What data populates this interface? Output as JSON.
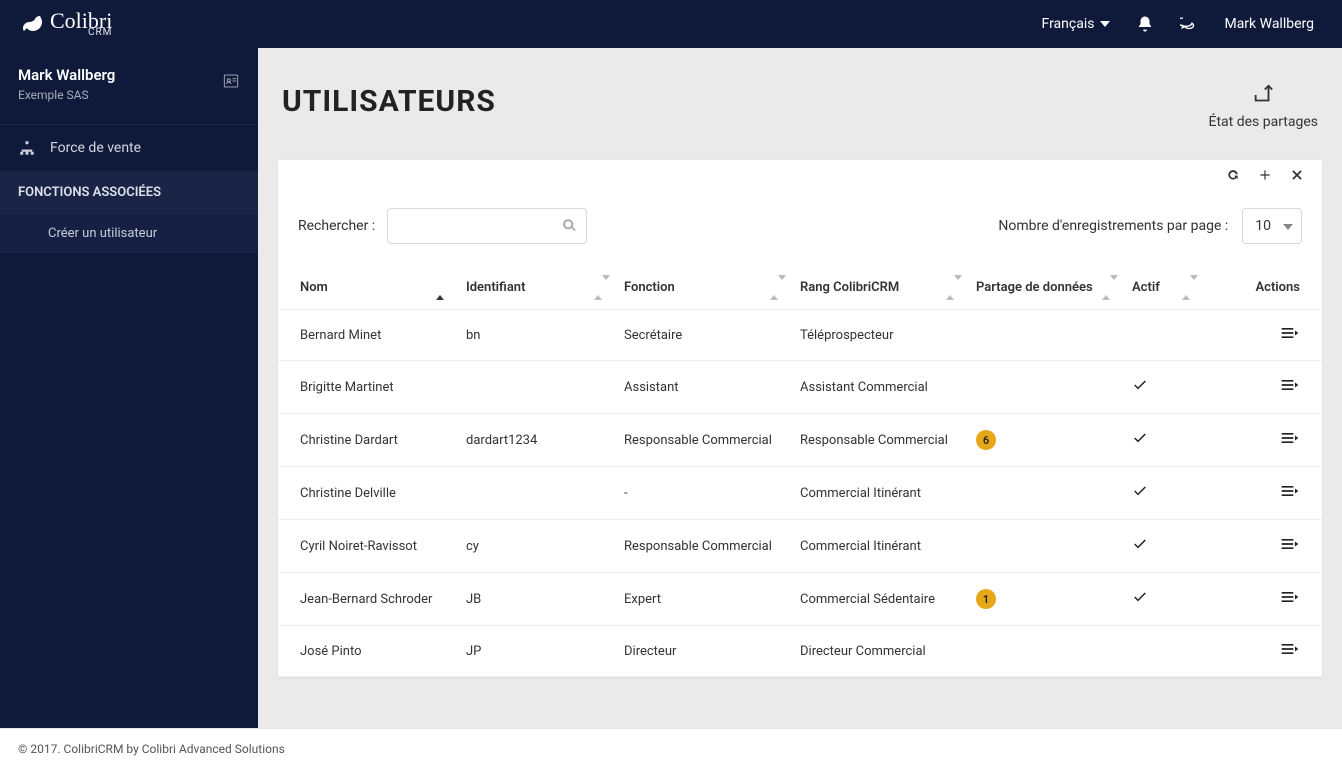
{
  "brand": {
    "name": "Colibri",
    "sub": "CRM"
  },
  "topbar": {
    "language": "Français",
    "user": "Mark Wallberg"
  },
  "sidebar": {
    "user_name": "Mark Wallberg",
    "org": "Exemple SAS",
    "nav": {
      "force_de_vente": "Force de vente"
    },
    "section_title": "FONCTIONS ASSOCIÉES",
    "create_user": "Créer un utilisateur"
  },
  "page": {
    "title": "UTILISATEURS",
    "share_state": "État des partages"
  },
  "controls": {
    "search_label": "Rechercher :",
    "page_size_label": "Nombre d'enregistrements par page :",
    "page_size_value": "10"
  },
  "columns": {
    "nom": "Nom",
    "identifiant": "Identifiant",
    "fonction": "Fonction",
    "rang": "Rang ColibriCRM",
    "partage": "Partage de données",
    "actif": "Actif",
    "actions": "Actions"
  },
  "rows": [
    {
      "nom": "Bernard Minet",
      "identifiant": "bn",
      "fonction": "Secrétaire",
      "rang": "Téléprospecteur",
      "partage": "",
      "actif": false
    },
    {
      "nom": "Brigitte Martinet",
      "identifiant": "",
      "fonction": "Assistant",
      "rang": "Assistant Commercial",
      "partage": "",
      "actif": true
    },
    {
      "nom": "Christine Dardart",
      "identifiant": "dardart1234",
      "fonction": "Responsable Commercial",
      "rang": "Responsable Commercial",
      "partage": "6",
      "actif": true
    },
    {
      "nom": "Christine Delville",
      "identifiant": "",
      "fonction": "-",
      "rang": "Commercial Itinérant",
      "partage": "",
      "actif": true
    },
    {
      "nom": "Cyril Noiret-Ravissot",
      "identifiant": "cy",
      "fonction": "Responsable Commercial",
      "rang": "Commercial Itinérant",
      "partage": "",
      "actif": true
    },
    {
      "nom": "Jean-Bernard Schroder",
      "identifiant": "JB",
      "fonction": "Expert",
      "rang": "Commercial Sédentaire",
      "partage": "1",
      "actif": true
    },
    {
      "nom": "José Pinto",
      "identifiant": "JP",
      "fonction": "Directeur",
      "rang": "Directeur Commercial",
      "partage": "",
      "actif": false
    }
  ],
  "footer": "© 2017. ColibriCRM by Colibri Advanced Solutions"
}
